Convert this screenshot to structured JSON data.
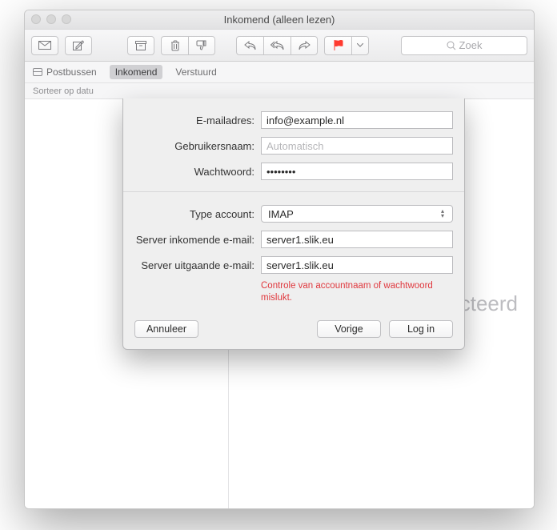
{
  "window": {
    "title": "Inkomend (alleen lezen)"
  },
  "search": {
    "placeholder": "Zoek"
  },
  "favorites": {
    "items": [
      {
        "label": "Postbussen",
        "active": false
      },
      {
        "label": "Inkomend",
        "active": true
      },
      {
        "label": "Verstuurd",
        "active": false
      }
    ]
  },
  "sortbar": {
    "label": "Sorteer op datu"
  },
  "messageView": {
    "placeholder_partial": "cteerd"
  },
  "sheet": {
    "labels": {
      "email": "E-mailadres:",
      "username": "Gebruikersnaam:",
      "password": "Wachtwoord:",
      "account_type": "Type account:",
      "incoming": "Server inkomende e-mail:",
      "outgoing": "Server uitgaande e-mail:"
    },
    "values": {
      "email": "info@example.nl",
      "username_placeholder": "Automatisch",
      "password": "••••••••",
      "account_type": "IMAP",
      "incoming": "server1.slik.eu",
      "outgoing": "server1.slik.eu"
    },
    "error": "Controle van accountnaam of wachtwoord mislukt.",
    "buttons": {
      "cancel": "Annuleer",
      "previous": "Vorige",
      "login": "Log in"
    }
  }
}
